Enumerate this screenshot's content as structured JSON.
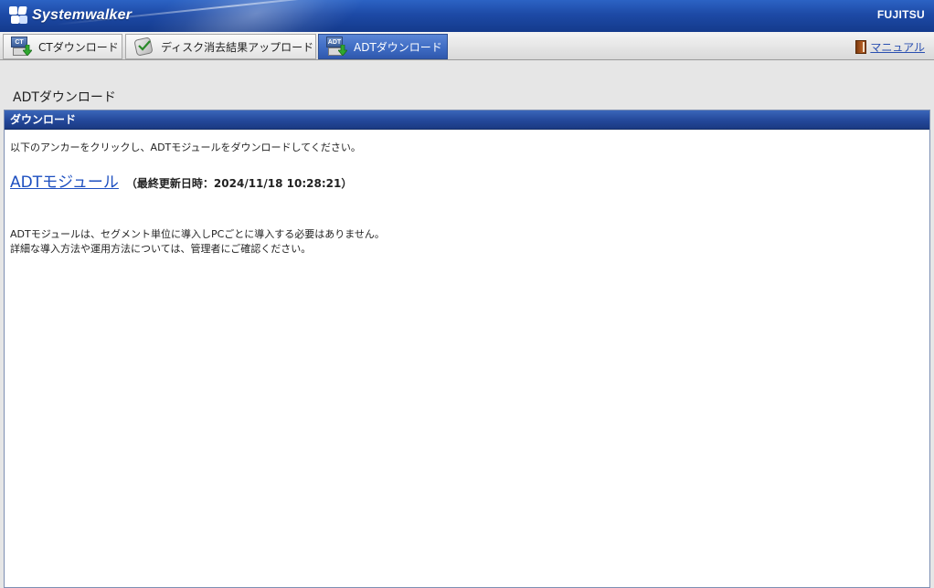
{
  "header": {
    "product_name": "Systemwalker",
    "vendor_name": "FUJITSU"
  },
  "tabs": [
    {
      "label": "CTダウンロード",
      "icon": "ct-download-icon",
      "active": false
    },
    {
      "label": "ディスク消去結果アップロード",
      "icon": "disk-erase-upload-icon",
      "active": false
    },
    {
      "label": "ADTダウンロード",
      "icon": "adt-download-icon",
      "active": true
    }
  ],
  "tab_icon_text": {
    "ct": "CT",
    "adt": "ADT"
  },
  "manual": {
    "label": "マニュアル",
    "icon": "book-icon"
  },
  "page": {
    "title": "ADTダウンロード"
  },
  "panel": {
    "header": "ダウンロード",
    "instruction": "以下のアンカーをクリックし、ADTモジュールをダウンロードしてください。",
    "module_link": "ADTモジュール",
    "last_updated": "（最終更新日時：2024/11/18 10:28:21）",
    "notes": [
      "ADTモジュールは、セグメント単位に導入しPCごとに導入する必要はありません。",
      "詳細な導入方法や運用方法については、管理者にご確認ください。"
    ]
  },
  "colors": {
    "banner": "#1d4aa6",
    "active_tab": "#3d6ac2",
    "panel_header": "#24489a",
    "link": "#1d4fc0"
  }
}
